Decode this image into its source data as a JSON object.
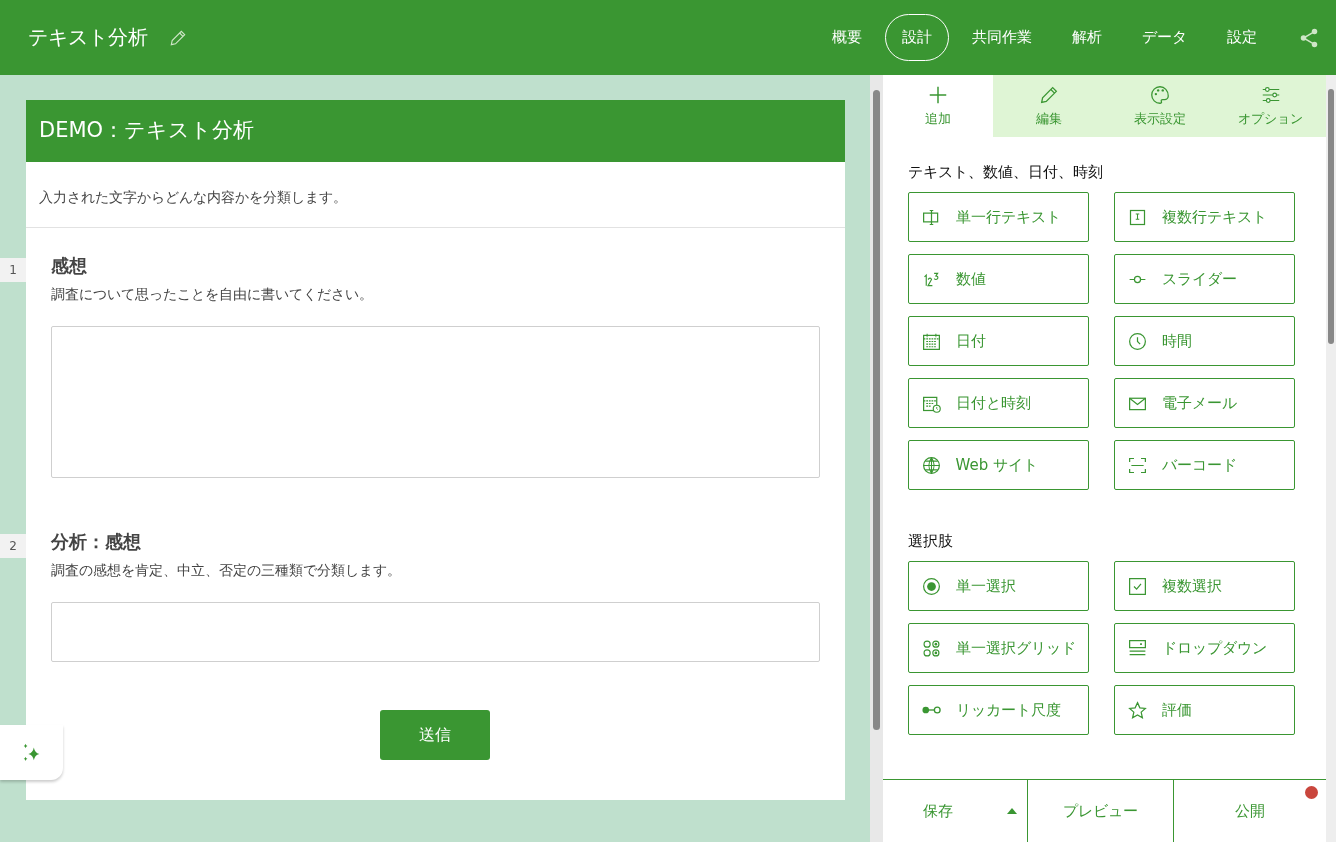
{
  "header": {
    "title": "テキスト分析",
    "nav": [
      {
        "label": "概要",
        "selected": false
      },
      {
        "label": "設計",
        "selected": true
      },
      {
        "label": "共同作業",
        "selected": false
      },
      {
        "label": "解析",
        "selected": false
      },
      {
        "label": "データ",
        "selected": false
      },
      {
        "label": "設定",
        "selected": false
      }
    ]
  },
  "form": {
    "title": "DEMO：テキスト分析",
    "description": "入力された文字からどんな内容かを分類します。",
    "questions": [
      {
        "number": "1",
        "title": "感想",
        "hint": "調査について思ったことを自由に書いてください。",
        "kind": "multiline"
      },
      {
        "number": "2",
        "title": "分析：感想",
        "hint": "調査の感想を肯定、中立、否定の三種類で分類します。",
        "kind": "single"
      }
    ],
    "submit": "送信"
  },
  "panel": {
    "tabs": [
      {
        "label": "追加",
        "kind": "plus",
        "selected": true
      },
      {
        "label": "編集",
        "kind": "pencil",
        "selected": false
      },
      {
        "label": "表示設定",
        "kind": "palette",
        "selected": false
      },
      {
        "label": "オプション",
        "kind": "sliders",
        "selected": false
      }
    ],
    "sections": [
      {
        "title": "テキスト、数値、日付、時刻",
        "items": [
          {
            "label": "単一行テキスト",
            "kind": "singleline"
          },
          {
            "label": "複数行テキスト",
            "kind": "multiline"
          },
          {
            "label": "数値",
            "kind": "number"
          },
          {
            "label": "スライダー",
            "kind": "slider"
          },
          {
            "label": "日付",
            "kind": "date"
          },
          {
            "label": "時間",
            "kind": "time"
          },
          {
            "label": "日付と時刻",
            "kind": "datetime"
          },
          {
            "label": "電子メール",
            "kind": "email"
          },
          {
            "label": "Web サイト",
            "kind": "web"
          },
          {
            "label": "バーコード",
            "kind": "barcode"
          }
        ]
      },
      {
        "title": "選択肢",
        "items": [
          {
            "label": "単一選択",
            "kind": "radio"
          },
          {
            "label": "複数選択",
            "kind": "checkbox"
          },
          {
            "label": "単一選択グリッド",
            "kind": "grid"
          },
          {
            "label": "ドロップダウン",
            "kind": "dropdown"
          },
          {
            "label": "リッカート尺度",
            "kind": "likert"
          },
          {
            "label": "評価",
            "kind": "star"
          }
        ]
      }
    ]
  },
  "footer": {
    "save": "保存",
    "preview": "プレビュー",
    "publish": "公開"
  }
}
